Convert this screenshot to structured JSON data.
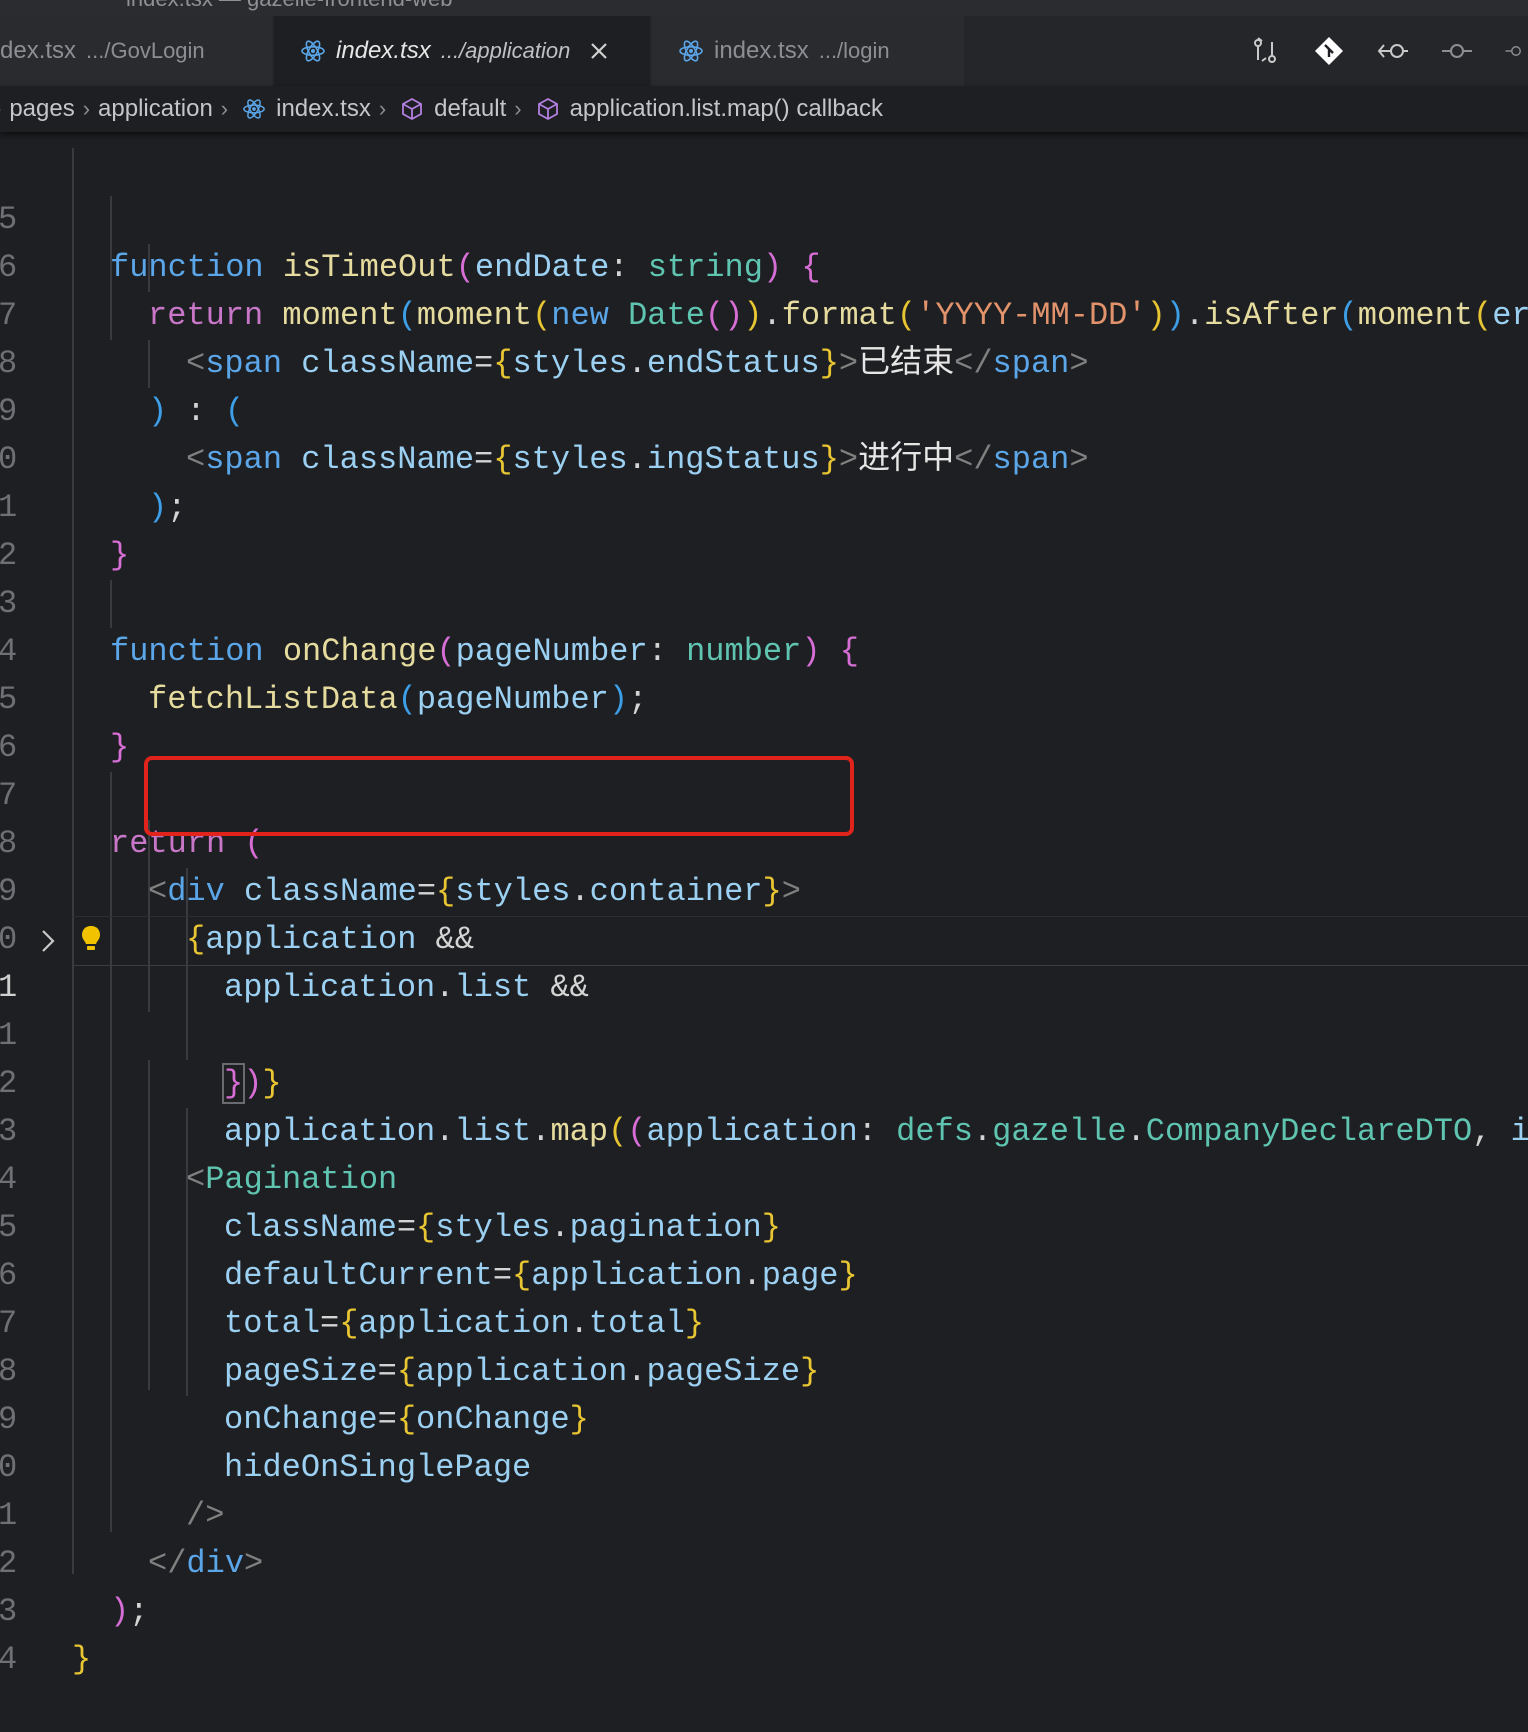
{
  "window": {
    "title": "index.tsx — gazelle-frontend-web"
  },
  "tabs": [
    {
      "label": "dex.tsx",
      "description": ".../GovLogin",
      "active": false
    },
    {
      "label": "index.tsx",
      "description": ".../application",
      "active": true
    },
    {
      "label": "index.tsx",
      "description": ".../login",
      "active": false
    }
  ],
  "breadcrumb": {
    "items": [
      "pages",
      "application",
      "index.tsx",
      "default",
      "application.list.map() callback"
    ]
  },
  "editor": {
    "highlight_color": "#e0241b",
    "lines": [
      {
        "num": "5",
        "text": "function isTimeOut(endDate: string) {"
      },
      {
        "num": "6",
        "text": "return moment(moment(new Date()).format('YYYY-MM-DD')).isAfter(moment(er"
      },
      {
        "num": "7",
        "text": "<span className={styles.endStatus}>已结束</span>"
      },
      {
        "num": "8",
        "text": ") : ("
      },
      {
        "num": "9",
        "text": "<span className={styles.ingStatus}>进行中</span>"
      },
      {
        "num": "0",
        "text": ");"
      },
      {
        "num": "1",
        "text": "}"
      },
      {
        "num": "2",
        "text": ""
      },
      {
        "num": "3",
        "text": "function onChange(pageNumber: number) {"
      },
      {
        "num": "4",
        "text": "fetchListData(pageNumber);"
      },
      {
        "num": "5",
        "text": "}"
      },
      {
        "num": "6",
        "text": ""
      },
      {
        "num": "7",
        "text": "return ("
      },
      {
        "num": "8",
        "text": "<div className={styles.container}>"
      },
      {
        "num": "9",
        "text": "{application &&"
      },
      {
        "num": "0",
        "text": "application.list &&"
      },
      {
        "num": "1",
        "text": "application.list.map((application: defs.gazelle.CompanyDeclareDTO, i"
      },
      {
        "num": "1",
        "text": "})}"
      },
      {
        "num": "2",
        "text": ""
      },
      {
        "num": "3",
        "text": "<Pagination"
      },
      {
        "num": "4",
        "text": "className={styles.pagination}"
      },
      {
        "num": "5",
        "text": "defaultCurrent={application.page}"
      },
      {
        "num": "6",
        "text": "total={application.total}"
      },
      {
        "num": "7",
        "text": "pageSize={application.pageSize}"
      },
      {
        "num": "8",
        "text": "onChange={onChange}"
      },
      {
        "num": "9",
        "text": "hideOnSinglePage"
      },
      {
        "num": "0",
        "text": "/>"
      },
      {
        "num": "1",
        "text": "</div>"
      },
      {
        "num": "2",
        "text": ");"
      },
      {
        "num": "3",
        "text": "}"
      },
      {
        "num": "4",
        "text": ""
      }
    ]
  }
}
